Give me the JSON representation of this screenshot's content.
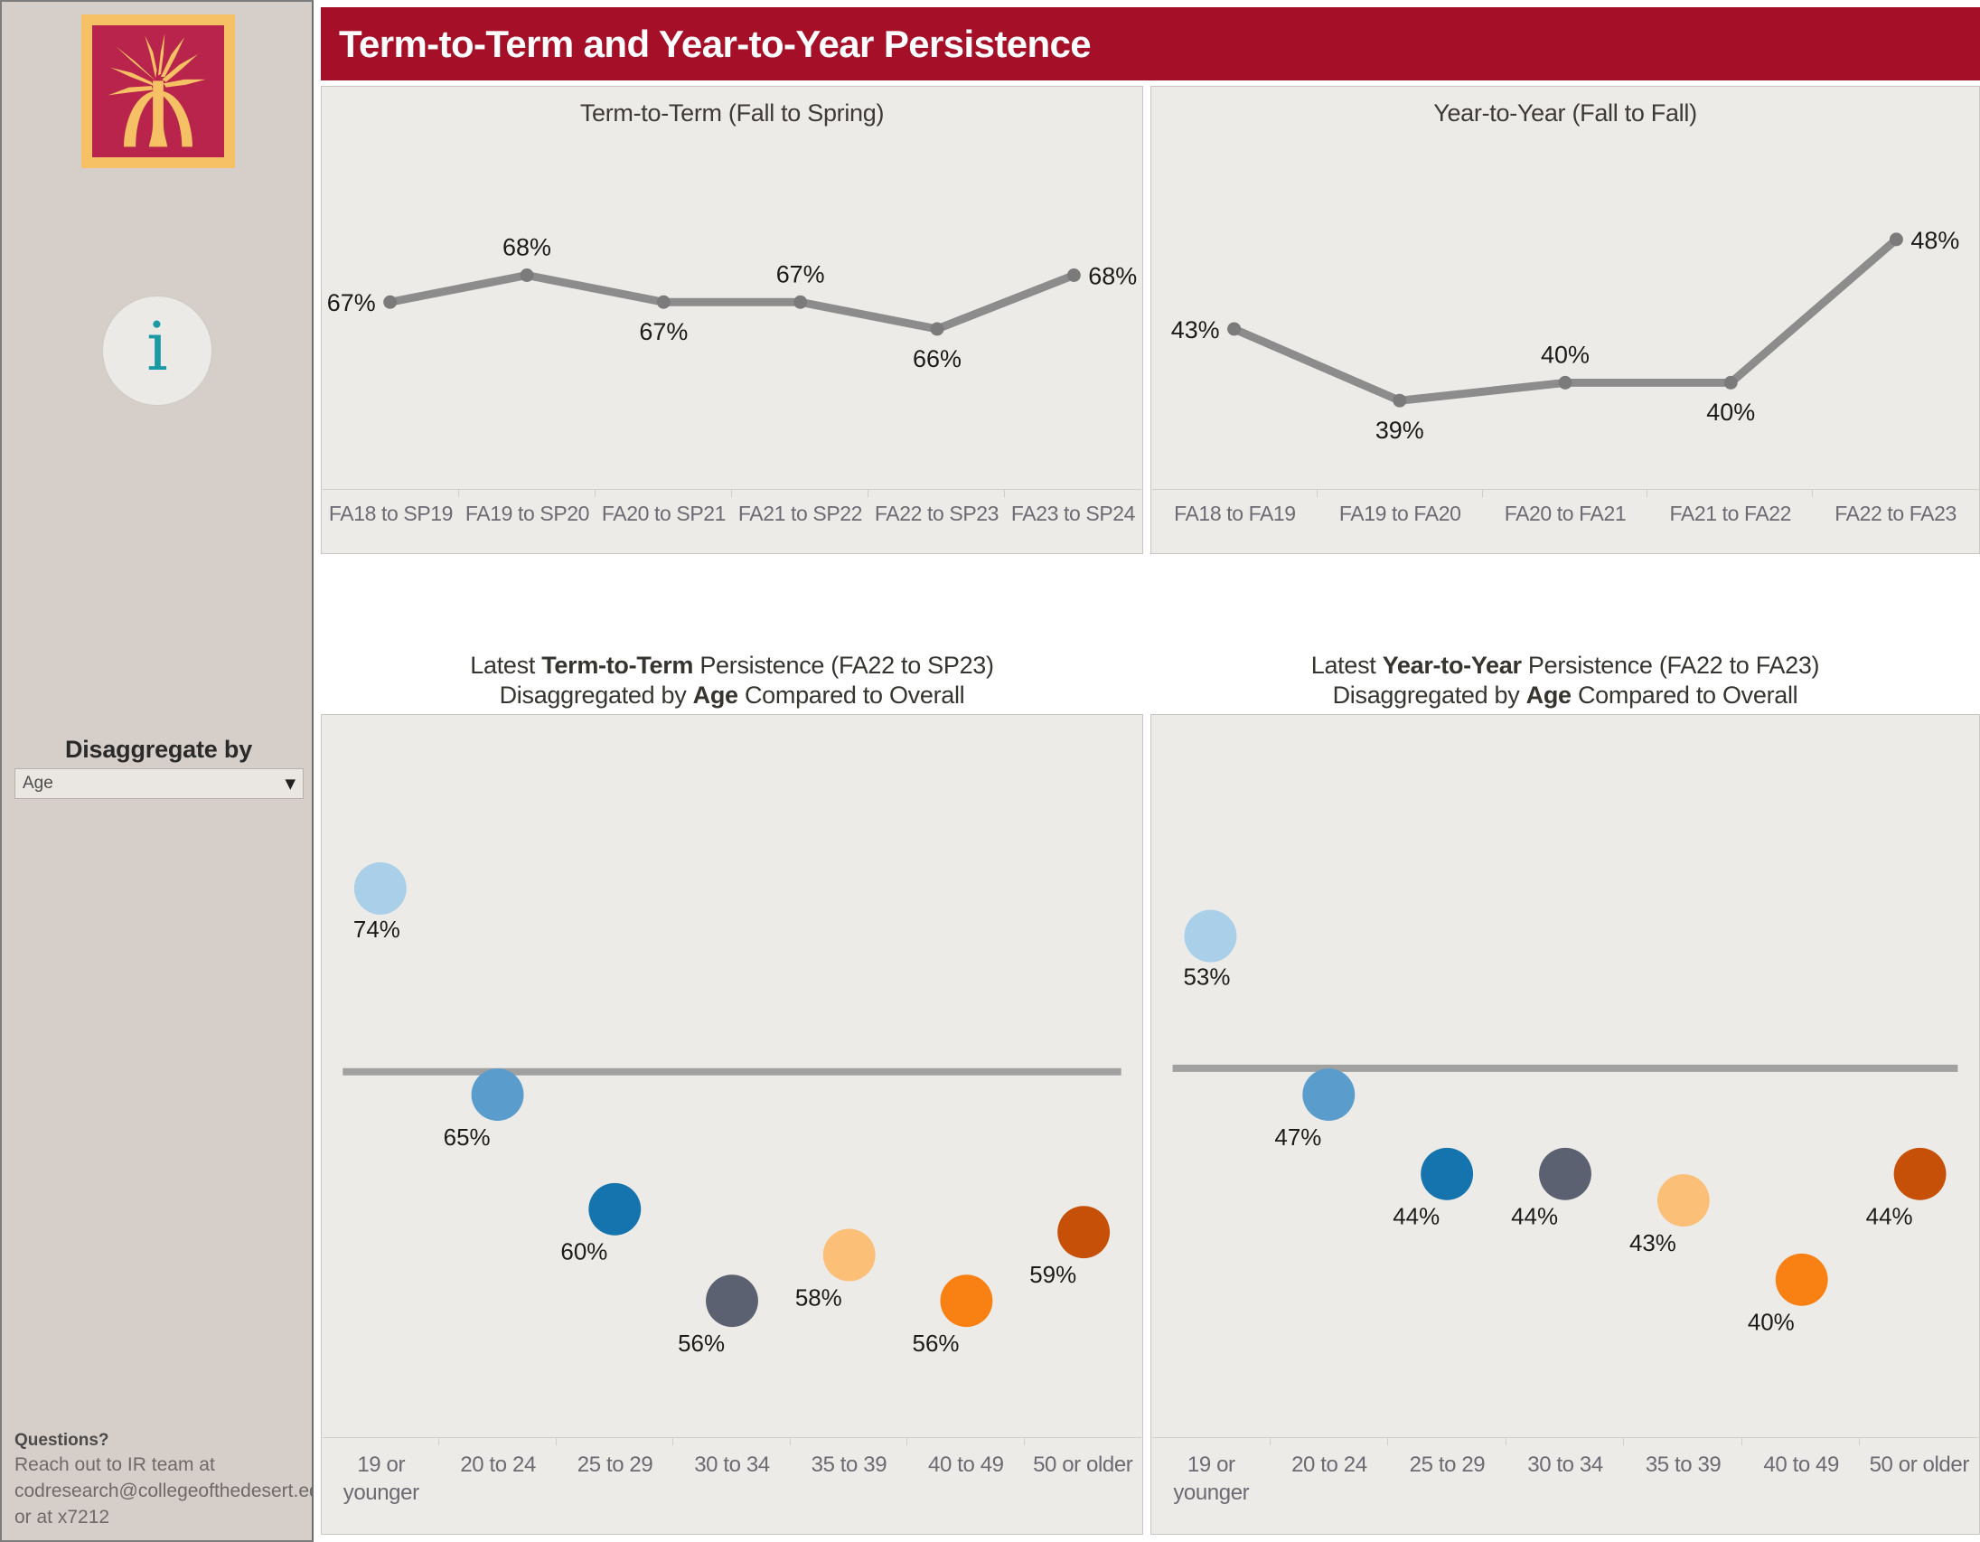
{
  "header": {
    "title": "Term-to-Term and Year-to-Year Persistence",
    "bar_color": "#a50f27"
  },
  "sidebar": {
    "logo_alt": "college-palm-logo",
    "logo_border_color": "#f6c164",
    "logo_bg_color": "#b8244b",
    "info_icon": "info-icon",
    "info_icon_color": "#1b9aa5",
    "disaggregate_label": "Disaggregate by",
    "disaggregate_value": "Age",
    "disaggregate_options": [
      "Age"
    ],
    "footer": {
      "heading": "Questions?",
      "line1": "Reach out to IR team at",
      "line2": "codresearch@collegeofthedesert.ed",
      "line3": "or at x7212"
    }
  },
  "panels": {
    "term_title": "Term-to-Term (Fall to Spring)",
    "year_title": "Year-to-Year (Fall to Fall)",
    "dis_left": {
      "l1_a": "Latest ",
      "l1_b": "Term-to-Term",
      "l1_c": " Persistence (FA22 to SP23)",
      "l2_a": "Disaggregated by ",
      "l2_b": "Age",
      "l2_c": " Compared to Overall"
    },
    "dis_right": {
      "l1_a": "Latest ",
      "l1_b": "Year-to-Year",
      "l1_c": " Persistence (FA22 to FA23)",
      "l2_a": "Disaggregated by ",
      "l2_b": "Age",
      "l2_c": " Compared to Overall"
    }
  },
  "chart_data": [
    {
      "type": "line",
      "title": "Term-to-Term (Fall to Spring)",
      "xlabel": "",
      "ylabel": "",
      "grid": false,
      "legend": "none",
      "ylim": [
        60,
        72
      ],
      "categories": [
        "FA18 to SP19",
        "FA19 to SP20",
        "FA20 to SP21",
        "FA21 to SP22",
        "FA22 to SP23",
        "FA23 to SP24"
      ],
      "values": [
        67,
        68,
        67,
        67,
        66,
        68
      ],
      "labels": [
        "67%",
        "68%",
        "67%",
        "67%",
        "66%",
        "68%"
      ],
      "label_positions": [
        "left",
        "above",
        "below",
        "above",
        "below",
        "right"
      ],
      "line_color": "#8c8c8c"
    },
    {
      "type": "line",
      "title": "Year-to-Year (Fall to Fall)",
      "xlabel": "",
      "ylabel": "",
      "grid": false,
      "legend": "none",
      "ylim": [
        34,
        52
      ],
      "categories": [
        "FA18 to FA19",
        "FA19 to FA20",
        "FA20 to FA21",
        "FA21 to FA22",
        "FA22 to FA23"
      ],
      "values": [
        43,
        39,
        40,
        40,
        48
      ],
      "labels": [
        "43%",
        "39%",
        "40%",
        "40%",
        "48%"
      ],
      "label_positions": [
        "left",
        "below",
        "above",
        "below",
        "right"
      ],
      "line_color": "#8c8c8c"
    },
    {
      "type": "scatter",
      "title": "Latest Term-to-Term Persistence (FA22 to SP23) Disaggregated by Age Compared to Overall",
      "xlabel": "",
      "ylabel": "",
      "grid": false,
      "legend": "none",
      "categories": [
        "19 or younger",
        "20 to 24",
        "25 to 29",
        "30 to 34",
        "35 to 39",
        "40 to 49",
        "50 or older"
      ],
      "values": [
        74,
        65,
        60,
        56,
        58,
        56,
        59
      ],
      "labels": [
        "74%",
        "65%",
        "60%",
        "56%",
        "58%",
        "56%",
        "59%"
      ],
      "colors": [
        "#a9cfe9",
        "#5a9ccc",
        "#1574ad",
        "#5b6170",
        "#fcbf78",
        "#f98012",
        "#c65008"
      ],
      "reference_line": {
        "label": "Overall",
        "value": 66,
        "color": "#a0a0a0"
      },
      "ylim": [
        50,
        80
      ]
    },
    {
      "type": "scatter",
      "title": "Latest Year-to-Year Persistence (FA22 to FA23) Disaggregated by Age Compared to Overall",
      "xlabel": "",
      "ylabel": "",
      "grid": false,
      "legend": "none",
      "categories": [
        "19 or younger",
        "20 to 24",
        "25 to 29",
        "30 to 34",
        "35 to 39",
        "40 to 49",
        "50 or older"
      ],
      "values": [
        53,
        47,
        44,
        44,
        43,
        40,
        44
      ],
      "labels": [
        "53%",
        "47%",
        "44%",
        "44%",
        "43%",
        "40%",
        "44%"
      ],
      "colors": [
        "#a9cfe9",
        "#5a9ccc",
        "#1574ad",
        "#5b6170",
        "#fcbf78",
        "#f98012",
        "#c65008"
      ],
      "reference_line": {
        "label": "Overall",
        "value": 48,
        "color": "#a0a0a0"
      },
      "ylim": [
        34,
        60
      ]
    }
  ]
}
